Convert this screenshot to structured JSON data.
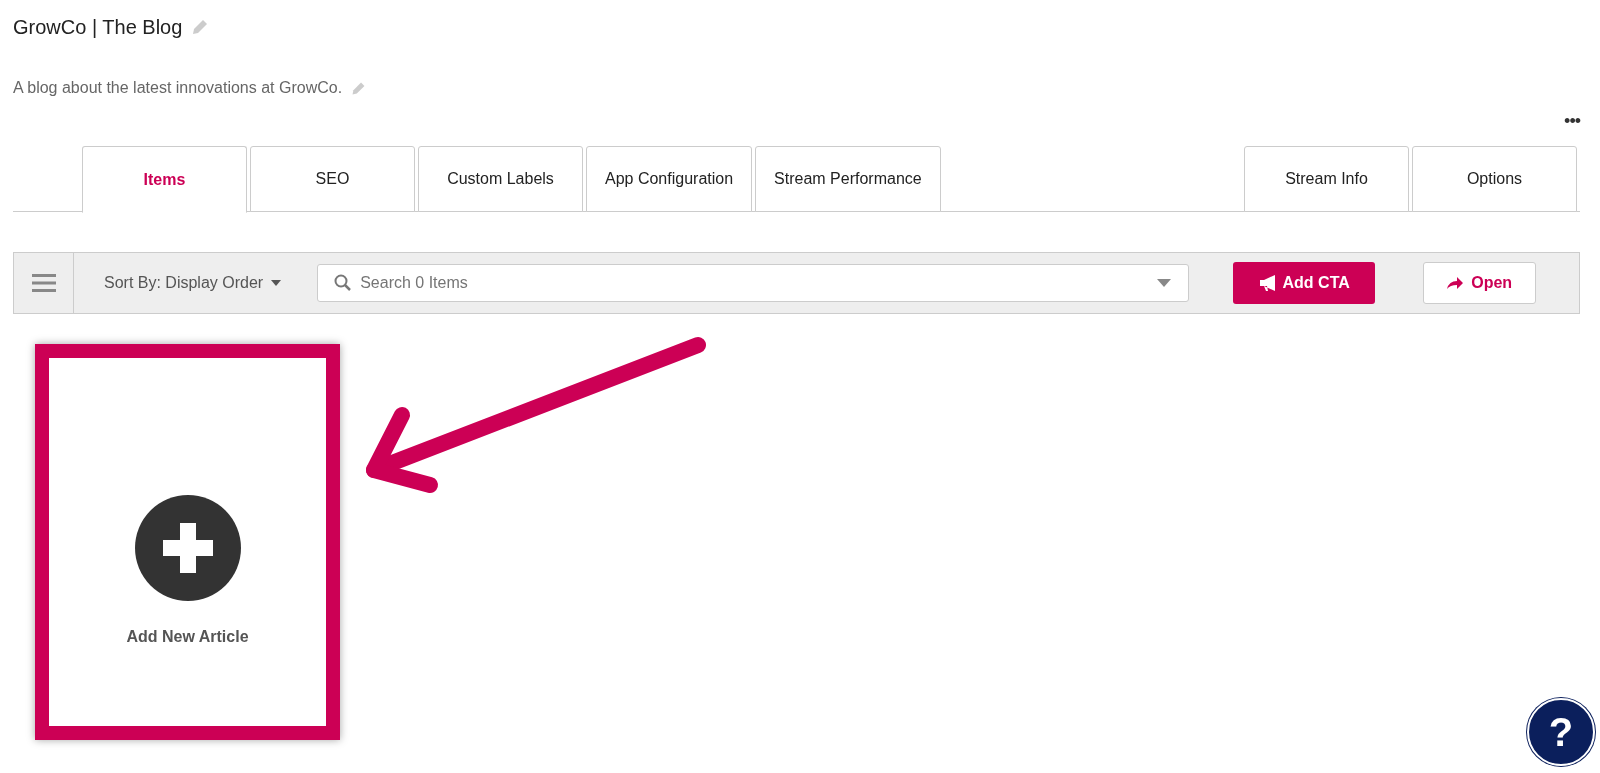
{
  "header": {
    "title": "GrowCo | The Blog",
    "description": "A blog about the latest innovations at GrowCo.",
    "more_menu": "•••"
  },
  "tabs": [
    {
      "label": "Items",
      "selected": true
    },
    {
      "label": "SEO",
      "selected": false
    },
    {
      "label": "Custom Labels",
      "selected": false
    },
    {
      "label": "App Configuration",
      "selected": false
    },
    {
      "label": "Stream Performance",
      "selected": false
    }
  ],
  "right_tabs": [
    {
      "label": "Stream Info",
      "selected": false
    },
    {
      "label": "Options",
      "selected": false
    }
  ],
  "toolbar": {
    "sort_label": "Sort By: Display Order",
    "search": {
      "placeholder": "Search 0 Items"
    },
    "add_cta_button": "Add CTA",
    "open_button": "Open"
  },
  "add_card": {
    "label": "Add New Article"
  },
  "help_button": "?"
}
